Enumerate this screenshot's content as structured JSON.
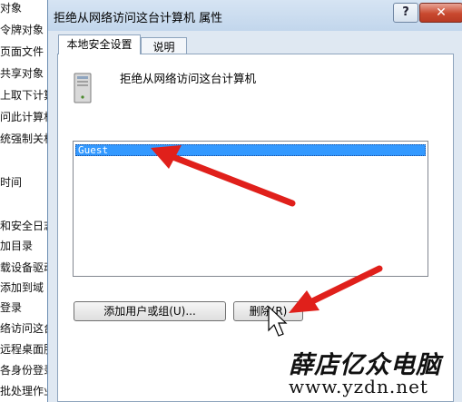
{
  "background_list": {
    "items": [
      "对象",
      "令牌对象",
      "页面文件",
      "共享对象",
      "上取下计算",
      "问此计算机",
      "统强制关机",
      "",
      "时间",
      "",
      "和安全日志",
      "加目录",
      "载设备驱动",
      "添加到域",
      "登录",
      "络访问这台",
      "远程桌面服",
      "各身份登录",
      "批处理作业"
    ]
  },
  "dialog": {
    "title": "拒绝从网络访问这台计算机 属性",
    "help_label": "?",
    "close_label": "✕",
    "tabs": [
      {
        "label": "本地安全设置"
      },
      {
        "label": "说明"
      }
    ],
    "policy_title": "拒绝从网络访问这台计算机",
    "users": [
      "Guest"
    ],
    "add_button": "添加用户或组(U)...",
    "remove_button": "删除(R)"
  },
  "watermark": {
    "name": "薛店亿众电脑",
    "url": "www.yzdn.net"
  },
  "colors": {
    "selection": "#3399ff",
    "annotation_arrow": "#e0201b"
  }
}
